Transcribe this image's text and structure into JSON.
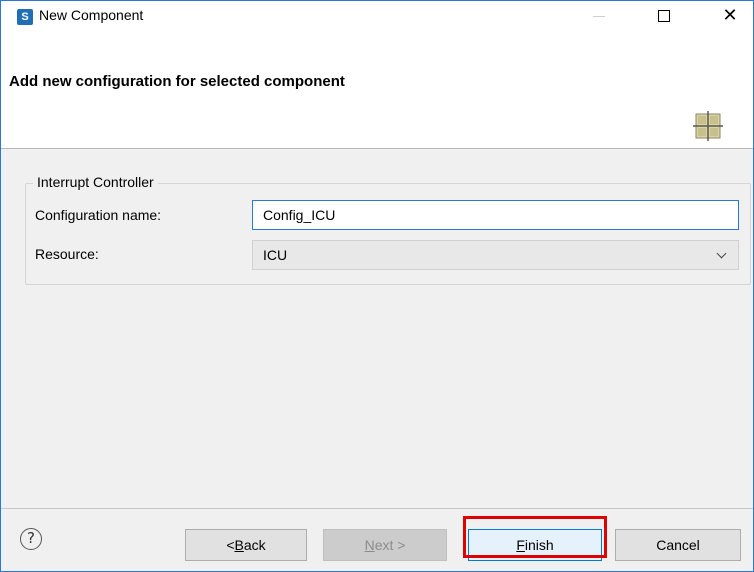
{
  "window": {
    "title": "New Component",
    "app_icon": "renesas-s-icon",
    "controls": [
      "minimize-icon",
      "maximize-icon",
      "close-icon"
    ]
  },
  "banner": {
    "title": "Add new configuration for selected component",
    "icon": "component-grid-icon"
  },
  "group": {
    "legend": "Interrupt Controller",
    "config_label": "Configuration name:",
    "config_value": "Config_ICU",
    "resource_label": "Resource:",
    "resource_value": "ICU"
  },
  "footer": {
    "help_icon": "help-icon",
    "back_prefix": "< ",
    "back_mnemonic": "B",
    "back_rest": "ack",
    "next_mnemonic": "N",
    "next_rest": "ext >",
    "finish_mnemonic": "F",
    "finish_rest": "inish",
    "cancel": "Cancel"
  },
  "colors": {
    "accent": "#2b79d6",
    "highlight": "#e00000"
  }
}
